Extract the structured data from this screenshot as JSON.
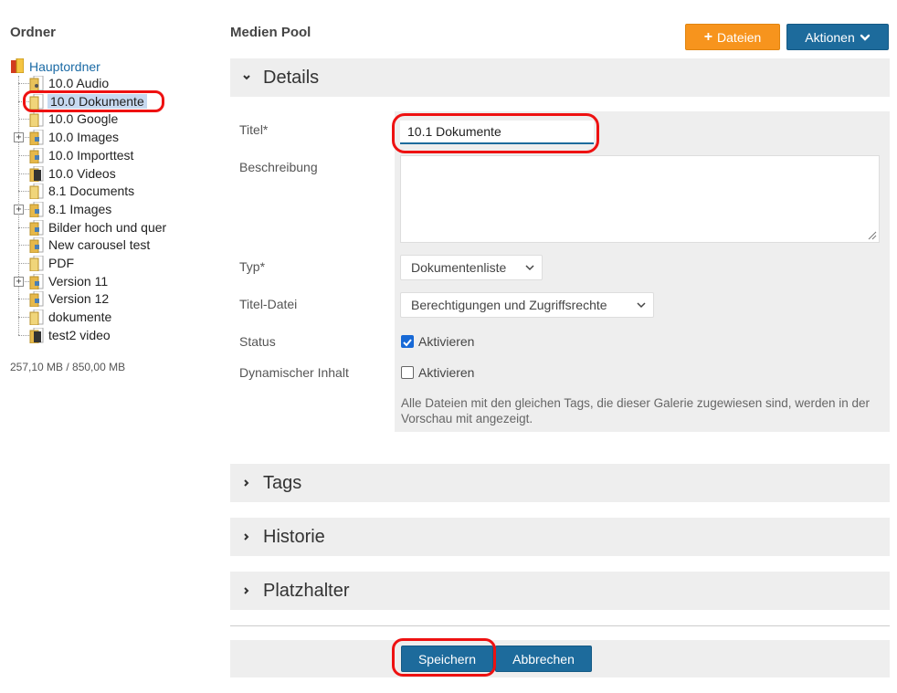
{
  "sidebar": {
    "heading": "Ordner",
    "root": {
      "label": "Hauptordner",
      "icon": "folder-root-icon"
    },
    "items": [
      {
        "label": "10.0 Audio",
        "icon": "audio-folder-icon",
        "expandable": false
      },
      {
        "label": "10.0 Dokumente",
        "icon": "document-folder-icon",
        "expandable": false,
        "selected": true
      },
      {
        "label": "10.0 Google",
        "icon": "document-folder-icon",
        "expandable": false
      },
      {
        "label": "10.0 Images",
        "icon": "image-folder-icon",
        "expandable": true
      },
      {
        "label": "10.0 Importtest",
        "icon": "image-folder-icon",
        "expandable": false
      },
      {
        "label": "10.0 Videos",
        "icon": "video-folder-icon",
        "expandable": false
      },
      {
        "label": "8.1 Documents",
        "icon": "document-folder-icon",
        "expandable": false
      },
      {
        "label": "8.1 Images",
        "icon": "image-folder-icon",
        "expandable": true
      },
      {
        "label": "Bilder hoch und quer",
        "icon": "image-folder-icon",
        "expandable": false
      },
      {
        "label": "New carousel test",
        "icon": "image-folder-icon",
        "expandable": false
      },
      {
        "label": "PDF",
        "icon": "document-folder-icon",
        "expandable": false
      },
      {
        "label": "Version 11",
        "icon": "image-folder-icon",
        "expandable": true
      },
      {
        "label": "Version 12",
        "icon": "image-folder-icon",
        "expandable": false
      },
      {
        "label": "dokumente",
        "icon": "document-folder-icon",
        "expandable": false
      },
      {
        "label": "test2 video",
        "icon": "video-folder-icon",
        "expandable": false
      }
    ],
    "quota": "257,10 MB / 850,00 MB"
  },
  "main": {
    "title": "Medien Pool",
    "buttons": {
      "files": "Dateien",
      "actions": "Aktionen"
    },
    "panels": {
      "details": "Details",
      "tags": "Tags",
      "history": "Historie",
      "placeholder": "Platzhalter"
    },
    "form": {
      "title_label": "Titel*",
      "title_value": "10.1 Dokumente",
      "description_label": "Beschreibung",
      "description_value": "",
      "type_label": "Typ*",
      "type_value": "Dokumentenliste",
      "title_file_label": "Titel-Datei",
      "title_file_value": "Berechtigungen und Zugriffsrechte",
      "status_label": "Status",
      "status_checkbox_label": "Aktivieren",
      "status_checked": true,
      "dynamic_label": "Dynamischer Inhalt",
      "dynamic_checkbox_label": "Aktivieren",
      "dynamic_checked": false,
      "help_text": "Alle Dateien mit den gleichen Tags, die dieser Galerie zugewiesen sind, werden in der Vorschau mit angezeigt."
    },
    "footer": {
      "save": "Speichern",
      "cancel": "Abbrechen"
    }
  },
  "colors": {
    "primary": "#1d6b9c",
    "accent": "#f7941d",
    "annotation": "#e11111",
    "panel": "#eeeeee",
    "link": "#1a6aa5"
  }
}
